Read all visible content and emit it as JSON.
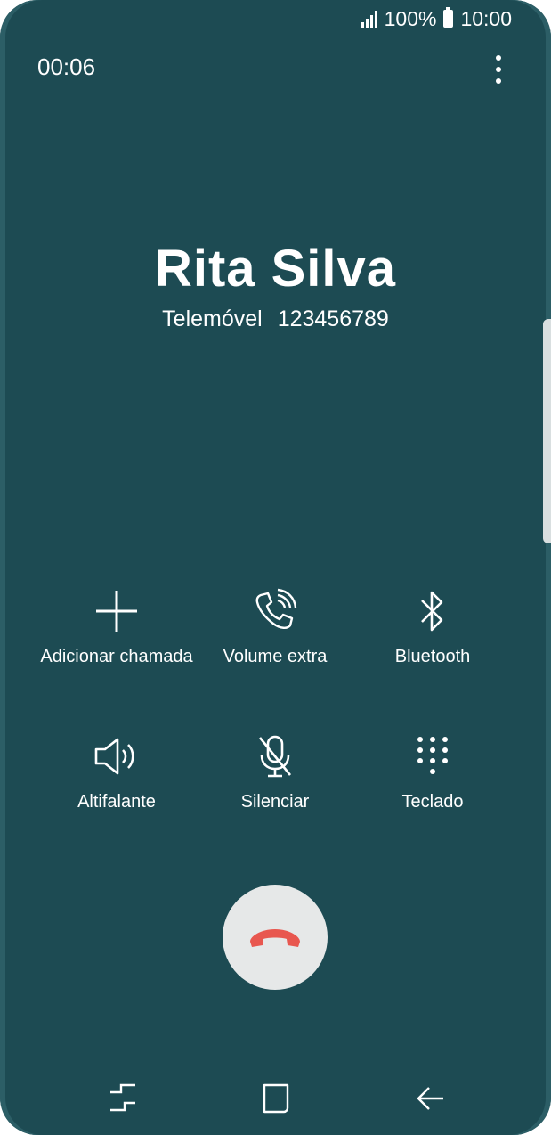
{
  "status_bar": {
    "battery": "100%",
    "time": "10:00",
    "icons": [
      "signal-icon",
      "battery-icon"
    ]
  },
  "call": {
    "duration": "00:06",
    "contact_name": "Rita Silva",
    "number_type": "Telemóvel",
    "number": "123456789"
  },
  "actions": [
    {
      "label": "Adicionar chamada",
      "icon": "add-call-icon"
    },
    {
      "label": "Volume extra",
      "icon": "volume-extra-icon"
    },
    {
      "label": "Bluetooth",
      "icon": "bluetooth-icon"
    },
    {
      "label": "Altifalante",
      "icon": "speaker-icon"
    },
    {
      "label": "Silenciar",
      "icon": "mute-mic-icon"
    },
    {
      "label": "Teclado",
      "icon": "keypad-icon"
    }
  ],
  "end_call": {
    "icon": "end-call-icon",
    "color": "#e8574f"
  },
  "nav": [
    "recent-apps-icon",
    "home-icon",
    "back-icon"
  ],
  "colors": {
    "background": "#1d4b53",
    "text": "#ffffff",
    "end_button": "#e6e8e8"
  }
}
